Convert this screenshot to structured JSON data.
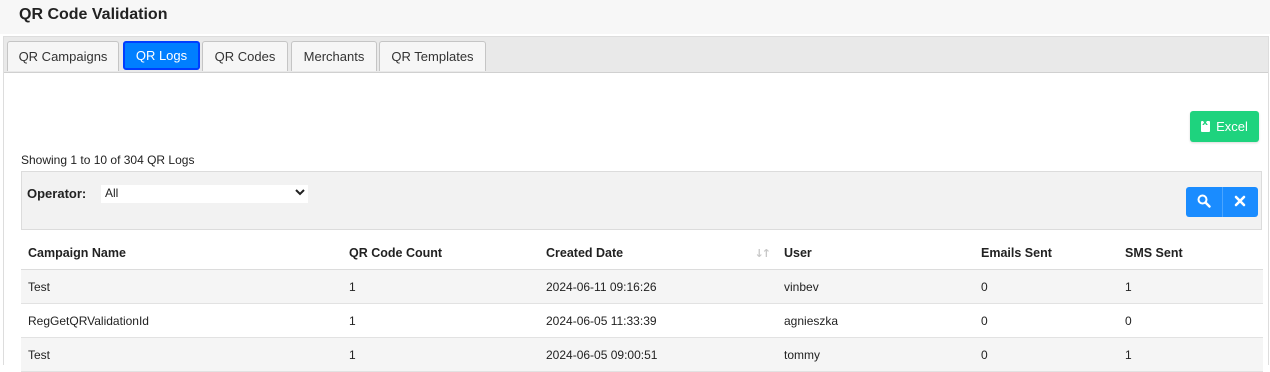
{
  "header": {
    "title": "QR Code Validation"
  },
  "tabs": [
    {
      "label": "QR Campaigns"
    },
    {
      "label": "QR Logs"
    },
    {
      "label": "QR Codes"
    },
    {
      "label": "Merchants"
    },
    {
      "label": "QR Templates"
    }
  ],
  "active_tab": "QR Logs",
  "toolbar": {
    "excel_label": "Excel"
  },
  "summary": {
    "showing_text": "Showing 1 to 10 of 304 QR Logs"
  },
  "filter": {
    "operator_label": "Operator:",
    "operator_value": "All",
    "search_icon": "search-icon",
    "clear_icon": "close-icon"
  },
  "table": {
    "columns": [
      "Campaign Name",
      "QR Code Count",
      "Created Date",
      "User",
      "Emails Sent",
      "SMS Sent"
    ],
    "sorted_column": "Created Date",
    "rows": [
      [
        "Test",
        "1",
        "2024-06-11 09:16:26",
        "vinbev",
        "0",
        "1"
      ],
      [
        "RegGetQRValidationId",
        "1",
        "2024-06-05 11:33:39",
        "agnieszka",
        "0",
        "0"
      ],
      [
        "Test",
        "1",
        "2024-06-05 09:00:51",
        "tommy",
        "0",
        "1"
      ]
    ]
  },
  "colors": {
    "active_tab": "#007fff",
    "excel_button": "#1ed37e",
    "action_buttons": "#1a8cff",
    "header_bg": "#f7f7f7"
  }
}
